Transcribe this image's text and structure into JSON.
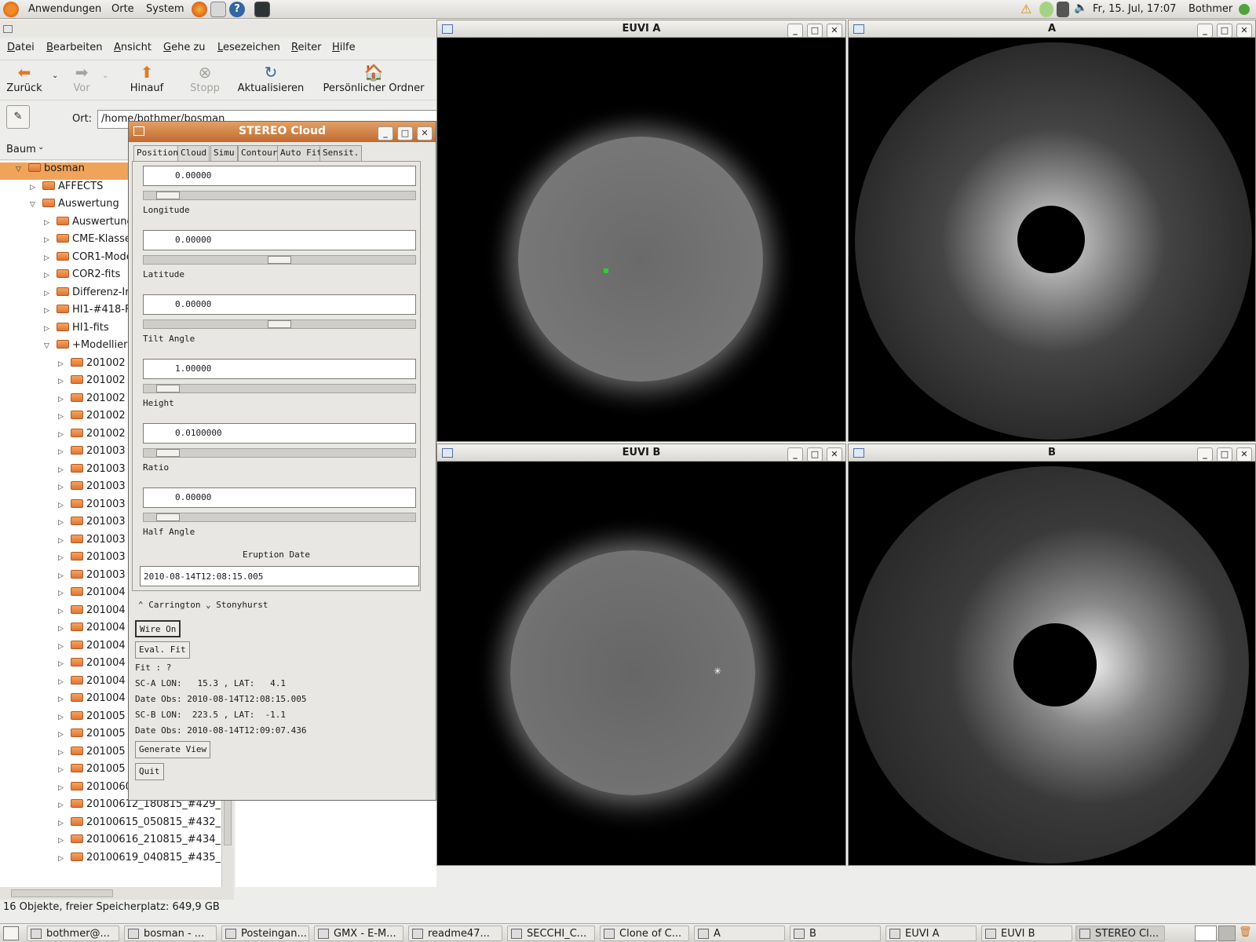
{
  "top_panel": {
    "menus": [
      "Anwendungen",
      "Orte",
      "System"
    ],
    "clock": "Fr, 15. Jul, 17:07",
    "user": "Bothmer"
  },
  "nautilus": {
    "menu": [
      "Datei",
      "Bearbeiten",
      "Ansicht",
      "Gehe zu",
      "Lesezeichen",
      "Reiter",
      "Hilfe"
    ],
    "toolbar": {
      "back": "Zurück",
      "forward": "Vor",
      "up": "Hinauf",
      "stop": "Stopp",
      "reload": "Aktualisieren",
      "home": "Persönlicher Ordner"
    },
    "location_label": "Ort:",
    "location_value": "/home/bothmer/bosman",
    "sidebar_mode": "Baum",
    "tree": [
      "bosman",
      "AFFECTS",
      "Auswertung",
      "Auswertung",
      "CME-Klasse",
      "COR1-Mode",
      "COR2-fits",
      "Differenz-Ir",
      "HI1-#418-F",
      "HI1-fits",
      "+Modellieru",
      "201002",
      "201002",
      "201002",
      "201002",
      "201002",
      "201003",
      "201003",
      "201003",
      "201003",
      "201003",
      "201003",
      "201003",
      "201003",
      "201004",
      "201004",
      "201004",
      "201004",
      "201004",
      "201004",
      "201004",
      "201005",
      "201005",
      "201005",
      "201005",
      "20100604_160815_#426_",
      "20100612_180815_#429_",
      "20100615_050815_#432_",
      "20100616_210815_#434_",
      "20100619_040815_#435_"
    ],
    "status": "16 Objekte, freier Speicherplatz: 649,9 GB"
  },
  "stereo_cloud": {
    "title": "STEREO Cloud",
    "tabs": [
      "Position",
      "Cloud",
      "Simu",
      "Contour",
      "Auto Fit",
      "Sensit."
    ],
    "fields": [
      {
        "label": "Longitude",
        "value": "0.00000",
        "slider": 0.05
      },
      {
        "label": "Latitude",
        "value": "0.00000",
        "slider": 0.5
      },
      {
        "label": "Tilt Angle",
        "value": "0.00000",
        "slider": 0.5
      },
      {
        "label": "Height",
        "value": "1.00000",
        "slider": 0.05
      },
      {
        "label": "Ratio",
        "value": "0.0100000",
        "slider": 0.05
      },
      {
        "label": "Half Angle",
        "value": "0.00000",
        "slider": 0.05
      }
    ],
    "eruption_label": "Eruption Date",
    "eruption_value": "2010-08-14T12:08:15.005",
    "radio_carrington": "Carrington",
    "radio_stonyhurst": "Stonyhurst",
    "wire_button": "Wire On",
    "eval_button": "Eval. Fit",
    "fit": "Fit : ?",
    "sca": "SC-A LON:   15.3 , LAT:   4.1",
    "date_obs_a": "Date Obs: 2010-08-14T12:08:15.005",
    "scb": "SC-B LON:  223.5 , LAT:  -1.1",
    "date_obs_b": "Date Obs: 2010-08-14T12:09:07.436",
    "generate_button": "Generate View",
    "quit_button": "Quit"
  },
  "windows": {
    "euvi_a": "EUVI A",
    "cor_a": "A",
    "euvi_b": "EUVI B",
    "cor_b": "B"
  },
  "taskbar": [
    "bothmer@...",
    "bosman - ...",
    "Posteingan...",
    "GMX - E-M...",
    "readme47...",
    "SECCHI_C...",
    "Clone of C...",
    "A",
    "B",
    "EUVI A",
    "EUVI B",
    "STEREO Cl..."
  ]
}
